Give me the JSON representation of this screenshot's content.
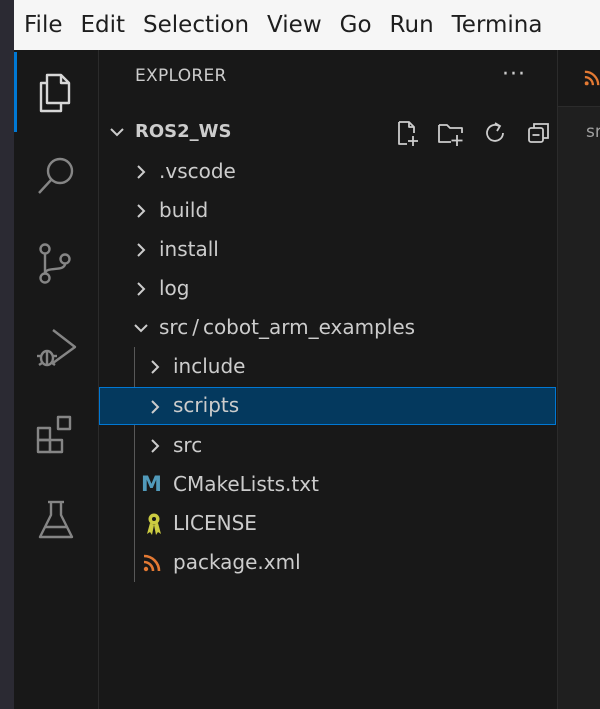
{
  "menubar": {
    "items": [
      "File",
      "Edit",
      "Selection",
      "View",
      "Go",
      "Run",
      "Termina"
    ]
  },
  "activitybar": {
    "items": [
      {
        "name": "explorer-icon",
        "active": true
      },
      {
        "name": "search-icon",
        "active": false
      },
      {
        "name": "source-control-icon",
        "active": false
      },
      {
        "name": "run-debug-icon",
        "active": false
      },
      {
        "name": "extensions-icon",
        "active": false
      },
      {
        "name": "testing-icon",
        "active": false
      }
    ]
  },
  "explorer": {
    "header": "EXPLORER",
    "more": "···",
    "root_label": "ROS2_WS",
    "tree": [
      {
        "label": ".vscode",
        "type": "folder"
      },
      {
        "label": "build",
        "type": "folder"
      },
      {
        "label": "install",
        "type": "folder"
      },
      {
        "label": "log",
        "type": "folder"
      },
      {
        "label_a": "src",
        "sep": "/",
        "label_b": "cobot_arm_examples",
        "type": "folder-open"
      },
      {
        "label": "include",
        "type": "folder"
      },
      {
        "label": "scripts",
        "type": "folder",
        "selected": true
      },
      {
        "label": "src",
        "type": "folder"
      },
      {
        "label": "CMakeLists.txt",
        "type": "file",
        "icon": "cmake-icon",
        "icon_glyph": "M"
      },
      {
        "label": "LICENSE",
        "type": "file",
        "icon": "license-icon"
      },
      {
        "label": "package.xml",
        "type": "file",
        "icon": "rss-xml-icon"
      }
    ]
  },
  "editor": {
    "breadcrumb_fragment": "sr"
  },
  "colors": {
    "accent": "#0078d4",
    "selection_bg": "#04395e",
    "cmake_icon": "#519aba",
    "license_icon": "#cbcb41",
    "xml_icon": "#e37933"
  }
}
